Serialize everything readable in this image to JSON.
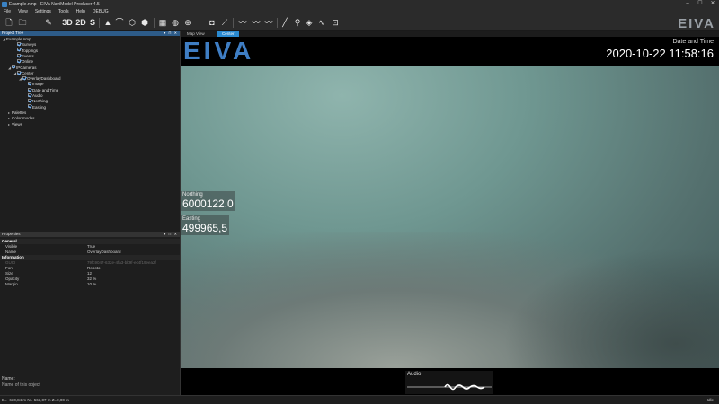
{
  "window": {
    "title": "Example.nmp - EIVA NaviModel Producer 4.5",
    "buttons": [
      "–",
      "☐",
      "✕"
    ]
  },
  "menu": [
    "File",
    "View",
    "Settings",
    "Tools",
    "Help",
    "DEBUG"
  ],
  "toolbar": {
    "items": [
      {
        "name": "new-file-icon",
        "glyph": "🗋"
      },
      {
        "name": "open-icon",
        "glyph": "🗀"
      },
      {
        "name": "pin-icon",
        "glyph": "✎"
      },
      {
        "name": "3d-button",
        "text": "3D"
      },
      {
        "name": "2d-button",
        "text": "2D"
      },
      {
        "name": "s-button",
        "text": "S"
      },
      {
        "name": "arrow-up-icon",
        "glyph": "▲"
      },
      {
        "name": "sweep-icon",
        "glyph": "⌒"
      },
      {
        "name": "cube-icon",
        "glyph": "⬡"
      },
      {
        "name": "layers-icon",
        "glyph": "⬢"
      },
      {
        "name": "grid-icon",
        "glyph": "▦"
      },
      {
        "name": "globe-icon",
        "glyph": "◍"
      },
      {
        "name": "globe-alt-icon",
        "glyph": "⊕"
      },
      {
        "name": "camera-icon",
        "glyph": "◘"
      },
      {
        "name": "ruler-icon",
        "glyph": "⟋"
      },
      {
        "name": "profile-icon",
        "glyph": "〰"
      },
      {
        "name": "profile2-icon",
        "glyph": "〰"
      },
      {
        "name": "profile3-icon",
        "glyph": "〰"
      },
      {
        "name": "line-icon",
        "glyph": "╱"
      },
      {
        "name": "marker-icon",
        "glyph": "⚲"
      },
      {
        "name": "shield-icon",
        "glyph": "◈"
      },
      {
        "name": "curve-icon",
        "glyph": "∿"
      },
      {
        "name": "chart-icon",
        "glyph": "⊡"
      }
    ],
    "logo": "EIVA"
  },
  "project_tree": {
    "header": "Project Tree",
    "items": [
      {
        "label": "Example.nmp",
        "indent": 0,
        "checkbox": false,
        "arrow": "◢"
      },
      {
        "label": "Surveys",
        "indent": 2,
        "checkbox": true,
        "arrow": ""
      },
      {
        "label": "Toppings",
        "indent": 2,
        "checkbox": true,
        "arrow": ""
      },
      {
        "label": "Events",
        "indent": 2,
        "checkbox": true,
        "arrow": ""
      },
      {
        "label": "Online",
        "indent": 2,
        "checkbox": true,
        "arrow": ""
      },
      {
        "label": "IPCameras",
        "indent": 1,
        "checkbox": true,
        "arrow": "◢"
      },
      {
        "label": "Center",
        "indent": 2,
        "checkbox": true,
        "arrow": "◢"
      },
      {
        "label": "OverlayDashboard",
        "indent": 3,
        "checkbox": true,
        "arrow": "◢"
      },
      {
        "label": "Image",
        "indent": 4,
        "checkbox": true,
        "arrow": ""
      },
      {
        "label": "Date and Time",
        "indent": 4,
        "checkbox": true,
        "arrow": ""
      },
      {
        "label": "Audio",
        "indent": 4,
        "checkbox": true,
        "arrow": ""
      },
      {
        "label": "Northing",
        "indent": 4,
        "checkbox": true,
        "arrow": ""
      },
      {
        "label": "Easting",
        "indent": 4,
        "checkbox": true,
        "arrow": ""
      },
      {
        "label": "Palettes",
        "indent": 1,
        "checkbox": false,
        "arrow": "▸"
      },
      {
        "label": "Color modes",
        "indent": 1,
        "checkbox": false,
        "arrow": "▸"
      },
      {
        "label": "Views",
        "indent": 1,
        "checkbox": false,
        "arrow": "▸"
      }
    ]
  },
  "properties": {
    "header": "Properties",
    "categories": [
      {
        "name": "General",
        "rows": [
          {
            "key": "Visible",
            "value": "True",
            "dim": false
          },
          {
            "key": "Name",
            "value": "OverlayDashboard",
            "dim": false
          }
        ]
      },
      {
        "name": "Information",
        "rows": [
          {
            "key": "GUID",
            "value": "79fc9047-632e-4fa3-bb9f-ec4f19eea2f",
            "dim": true
          },
          {
            "key": "Font",
            "value": "Roboto",
            "dim": false
          },
          {
            "key": "Size",
            "value": "12",
            "dim": false
          },
          {
            "key": "Opacity",
            "value": "32 %",
            "dim": false
          },
          {
            "key": "Margin",
            "value": "10 %",
            "dim": false
          }
        ]
      }
    ],
    "help_title": "Name:",
    "help_text": "Name of this object"
  },
  "tabs": [
    {
      "label": "Map View",
      "active": false
    },
    {
      "label": "Center",
      "active": true
    }
  ],
  "view": {
    "logo": "EIVA",
    "datetime_label": "Date and Time",
    "datetime_value": "2020-10-22 11:58:16",
    "northing_label": "Northing",
    "northing_value": "6000122,0",
    "easting_label": "Easting",
    "easting_value": "499965,5",
    "audio_label": "Audio"
  },
  "status": {
    "coords": "E= -630,84 m N=-563,07 m Z=0,00 m",
    "state": "Idle"
  }
}
